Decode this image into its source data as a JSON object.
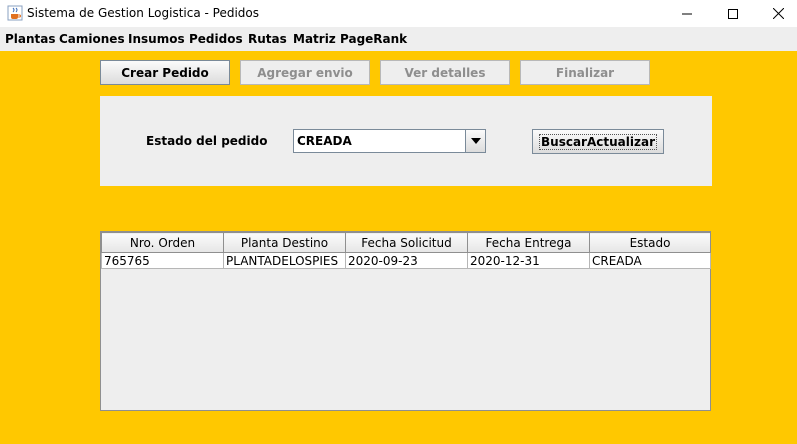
{
  "window": {
    "title": "Sistema de Gestion Logistica - Pedidos",
    "icon": "java-cup-icon",
    "controls": [
      "minimize-icon",
      "maximize-icon",
      "close-icon"
    ]
  },
  "menu": {
    "items": [
      "Plantas",
      "Camiones",
      "Insumos",
      "Pedidos",
      "Rutas",
      "Matriz",
      "PageRank"
    ]
  },
  "toolbar": {
    "crear_pedido": "Crear Pedido",
    "agregar_envio": "Agregar envio",
    "ver_detalles": "Ver detalles",
    "finalizar": "Finalizar"
  },
  "filter": {
    "label": "Estado del pedido",
    "selected": "CREADA",
    "search_button": "BuscarActualizar"
  },
  "table": {
    "columns": [
      "Nro. Orden",
      "Planta Destino",
      "Fecha Solicitud",
      "Fecha Entrega",
      "Estado"
    ],
    "rows": [
      [
        "765765",
        "PLANTADELOSPIES",
        "2020-09-23",
        "2020-12-31",
        "CREADA"
      ]
    ]
  },
  "colors": {
    "background": "#ffc800",
    "panel": "#eeeeee"
  }
}
